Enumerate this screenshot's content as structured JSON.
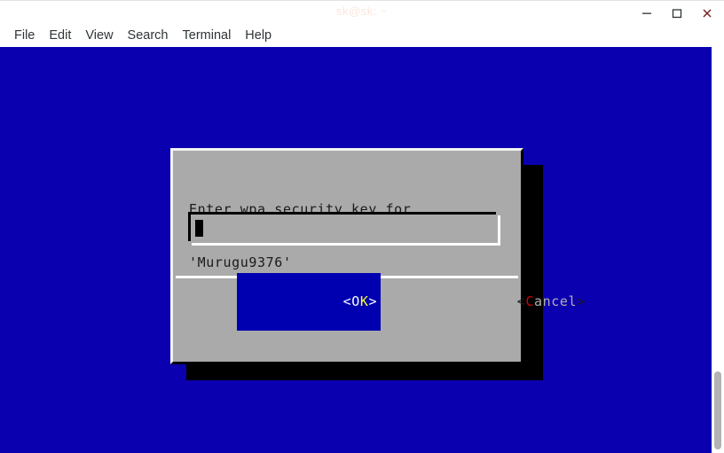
{
  "window": {
    "title": "sk@sk: ~",
    "controls": [
      {
        "name": "minimize-button",
        "glyph": "minimize-icon",
        "label": "Minimize"
      },
      {
        "name": "maximize-button",
        "glyph": "maximize-icon",
        "label": "Maximize"
      },
      {
        "name": "close-button",
        "glyph": "close-icon",
        "label": "Close"
      }
    ]
  },
  "menubar": {
    "items": [
      {
        "label": "File"
      },
      {
        "label": "Edit"
      },
      {
        "label": "View"
      },
      {
        "label": "Search"
      },
      {
        "label": "Terminal"
      },
      {
        "label": "Help"
      }
    ]
  },
  "terminal": {
    "background_color": "#0b00b0",
    "scrollbar": {
      "track_color": "#ffffff",
      "thumb_color": "#b3b3b3"
    }
  },
  "dialog": {
    "background_color": "#aaaaaa",
    "prompt_line_1": "Enter wpa security key for",
    "prompt_line_2": "'Murugu9376'",
    "input": {
      "value": "",
      "placeholder": "",
      "cursor": "block"
    },
    "buttons": [
      {
        "name": "ok-button",
        "left_bracket": "<",
        "label_first": "O",
        "label_rest": "K",
        "right_bracket": ">",
        "selected": true,
        "background_color": "#0000b0",
        "accent_color": "#ffff3b"
      },
      {
        "name": "cancel-button",
        "left_bracket": "<",
        "label_first": "C",
        "label_rest": "ancel",
        "right_bracket": ">",
        "selected": false,
        "background_color": "transparent",
        "accent_color": "#cc0000"
      }
    ]
  }
}
